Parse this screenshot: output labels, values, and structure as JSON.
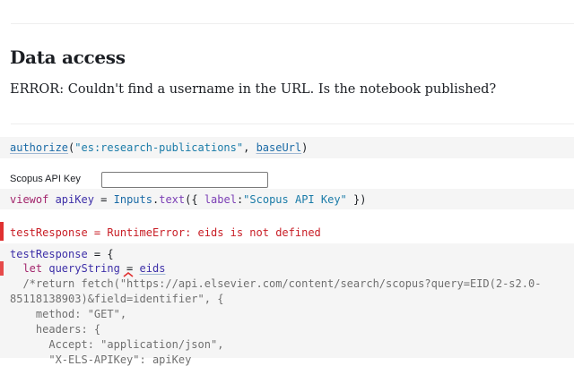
{
  "heading": "Data access",
  "error_message": "ERROR: Couldn't find a username in the URL. Is the notebook published?",
  "cells": {
    "authorize": {
      "fn": "authorize",
      "open": "(",
      "arg1": "\"es:research-publications\"",
      "sep": ", ",
      "arg2": "baseUrl",
      "close": ")"
    },
    "api_input": {
      "label": "Scopus API Key",
      "value": ""
    },
    "viewof": {
      "kw": "viewof",
      "name": " apiKey",
      "eq": " = ",
      "obj": "Inputs",
      "dot": ".",
      "method": "text",
      "open": "({ ",
      "prop": "label",
      "colon": ":",
      "str": "\"Scopus API Key\"",
      "close": " })"
    },
    "error_output": "testResponse = RuntimeError: eids is not defined",
    "test_response": {
      "line1_name": "testResponse",
      "line1_rest": " = {",
      "line2_kw": "  let",
      "line2_var": " queryString",
      "line2_eq": " = ",
      "line2_ref": "eids",
      "line3": "  /*return fetch(\"https://api.elsevier.com/content/search/scopus?query=EID(2-s2.0-",
      "line4": "85118138903)&field=identifier\", {",
      "line5": "    method: \"GET\",",
      "line6": "    headers: {",
      "line7": "      Accept: \"application/json\",",
      "line8": "      \"X-ELS-APIKey\": apiKey"
    }
  },
  "colors": {
    "error": "#c81d25",
    "cell_bg": "#f5f5f5",
    "keyword": "#a2246b",
    "string": "#1a7ba8"
  }
}
